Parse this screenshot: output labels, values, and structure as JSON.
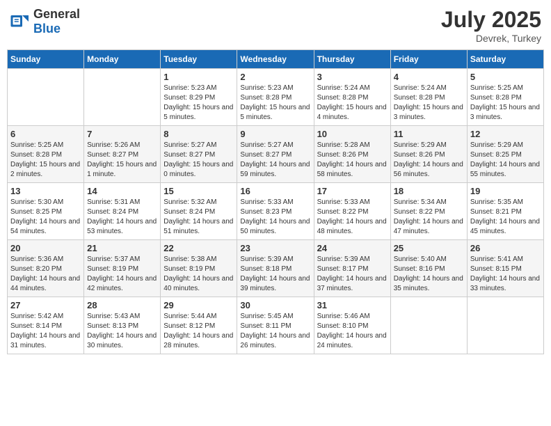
{
  "header": {
    "logo_general": "General",
    "logo_blue": "Blue",
    "title": "July 2025",
    "location": "Devrek, Turkey"
  },
  "weekdays": [
    "Sunday",
    "Monday",
    "Tuesday",
    "Wednesday",
    "Thursday",
    "Friday",
    "Saturday"
  ],
  "weeks": [
    [
      {
        "day": "",
        "sunrise": "",
        "sunset": "",
        "daylight": ""
      },
      {
        "day": "",
        "sunrise": "",
        "sunset": "",
        "daylight": ""
      },
      {
        "day": "1",
        "sunrise": "Sunrise: 5:23 AM",
        "sunset": "Sunset: 8:29 PM",
        "daylight": "Daylight: 15 hours and 5 minutes."
      },
      {
        "day": "2",
        "sunrise": "Sunrise: 5:23 AM",
        "sunset": "Sunset: 8:28 PM",
        "daylight": "Daylight: 15 hours and 5 minutes."
      },
      {
        "day": "3",
        "sunrise": "Sunrise: 5:24 AM",
        "sunset": "Sunset: 8:28 PM",
        "daylight": "Daylight: 15 hours and 4 minutes."
      },
      {
        "day": "4",
        "sunrise": "Sunrise: 5:24 AM",
        "sunset": "Sunset: 8:28 PM",
        "daylight": "Daylight: 15 hours and 3 minutes."
      },
      {
        "day": "5",
        "sunrise": "Sunrise: 5:25 AM",
        "sunset": "Sunset: 8:28 PM",
        "daylight": "Daylight: 15 hours and 3 minutes."
      }
    ],
    [
      {
        "day": "6",
        "sunrise": "Sunrise: 5:25 AM",
        "sunset": "Sunset: 8:28 PM",
        "daylight": "Daylight: 15 hours and 2 minutes."
      },
      {
        "day": "7",
        "sunrise": "Sunrise: 5:26 AM",
        "sunset": "Sunset: 8:27 PM",
        "daylight": "Daylight: 15 hours and 1 minute."
      },
      {
        "day": "8",
        "sunrise": "Sunrise: 5:27 AM",
        "sunset": "Sunset: 8:27 PM",
        "daylight": "Daylight: 15 hours and 0 minutes."
      },
      {
        "day": "9",
        "sunrise": "Sunrise: 5:27 AM",
        "sunset": "Sunset: 8:27 PM",
        "daylight": "Daylight: 14 hours and 59 minutes."
      },
      {
        "day": "10",
        "sunrise": "Sunrise: 5:28 AM",
        "sunset": "Sunset: 8:26 PM",
        "daylight": "Daylight: 14 hours and 58 minutes."
      },
      {
        "day": "11",
        "sunrise": "Sunrise: 5:29 AM",
        "sunset": "Sunset: 8:26 PM",
        "daylight": "Daylight: 14 hours and 56 minutes."
      },
      {
        "day": "12",
        "sunrise": "Sunrise: 5:29 AM",
        "sunset": "Sunset: 8:25 PM",
        "daylight": "Daylight: 14 hours and 55 minutes."
      }
    ],
    [
      {
        "day": "13",
        "sunrise": "Sunrise: 5:30 AM",
        "sunset": "Sunset: 8:25 PM",
        "daylight": "Daylight: 14 hours and 54 minutes."
      },
      {
        "day": "14",
        "sunrise": "Sunrise: 5:31 AM",
        "sunset": "Sunset: 8:24 PM",
        "daylight": "Daylight: 14 hours and 53 minutes."
      },
      {
        "day": "15",
        "sunrise": "Sunrise: 5:32 AM",
        "sunset": "Sunset: 8:24 PM",
        "daylight": "Daylight: 14 hours and 51 minutes."
      },
      {
        "day": "16",
        "sunrise": "Sunrise: 5:33 AM",
        "sunset": "Sunset: 8:23 PM",
        "daylight": "Daylight: 14 hours and 50 minutes."
      },
      {
        "day": "17",
        "sunrise": "Sunrise: 5:33 AM",
        "sunset": "Sunset: 8:22 PM",
        "daylight": "Daylight: 14 hours and 48 minutes."
      },
      {
        "day": "18",
        "sunrise": "Sunrise: 5:34 AM",
        "sunset": "Sunset: 8:22 PM",
        "daylight": "Daylight: 14 hours and 47 minutes."
      },
      {
        "day": "19",
        "sunrise": "Sunrise: 5:35 AM",
        "sunset": "Sunset: 8:21 PM",
        "daylight": "Daylight: 14 hours and 45 minutes."
      }
    ],
    [
      {
        "day": "20",
        "sunrise": "Sunrise: 5:36 AM",
        "sunset": "Sunset: 8:20 PM",
        "daylight": "Daylight: 14 hours and 44 minutes."
      },
      {
        "day": "21",
        "sunrise": "Sunrise: 5:37 AM",
        "sunset": "Sunset: 8:19 PM",
        "daylight": "Daylight: 14 hours and 42 minutes."
      },
      {
        "day": "22",
        "sunrise": "Sunrise: 5:38 AM",
        "sunset": "Sunset: 8:19 PM",
        "daylight": "Daylight: 14 hours and 40 minutes."
      },
      {
        "day": "23",
        "sunrise": "Sunrise: 5:39 AM",
        "sunset": "Sunset: 8:18 PM",
        "daylight": "Daylight: 14 hours and 39 minutes."
      },
      {
        "day": "24",
        "sunrise": "Sunrise: 5:39 AM",
        "sunset": "Sunset: 8:17 PM",
        "daylight": "Daylight: 14 hours and 37 minutes."
      },
      {
        "day": "25",
        "sunrise": "Sunrise: 5:40 AM",
        "sunset": "Sunset: 8:16 PM",
        "daylight": "Daylight: 14 hours and 35 minutes."
      },
      {
        "day": "26",
        "sunrise": "Sunrise: 5:41 AM",
        "sunset": "Sunset: 8:15 PM",
        "daylight": "Daylight: 14 hours and 33 minutes."
      }
    ],
    [
      {
        "day": "27",
        "sunrise": "Sunrise: 5:42 AM",
        "sunset": "Sunset: 8:14 PM",
        "daylight": "Daylight: 14 hours and 31 minutes."
      },
      {
        "day": "28",
        "sunrise": "Sunrise: 5:43 AM",
        "sunset": "Sunset: 8:13 PM",
        "daylight": "Daylight: 14 hours and 30 minutes."
      },
      {
        "day": "29",
        "sunrise": "Sunrise: 5:44 AM",
        "sunset": "Sunset: 8:12 PM",
        "daylight": "Daylight: 14 hours and 28 minutes."
      },
      {
        "day": "30",
        "sunrise": "Sunrise: 5:45 AM",
        "sunset": "Sunset: 8:11 PM",
        "daylight": "Daylight: 14 hours and 26 minutes."
      },
      {
        "day": "31",
        "sunrise": "Sunrise: 5:46 AM",
        "sunset": "Sunset: 8:10 PM",
        "daylight": "Daylight: 14 hours and 24 minutes."
      },
      {
        "day": "",
        "sunrise": "",
        "sunset": "",
        "daylight": ""
      },
      {
        "day": "",
        "sunrise": "",
        "sunset": "",
        "daylight": ""
      }
    ]
  ]
}
